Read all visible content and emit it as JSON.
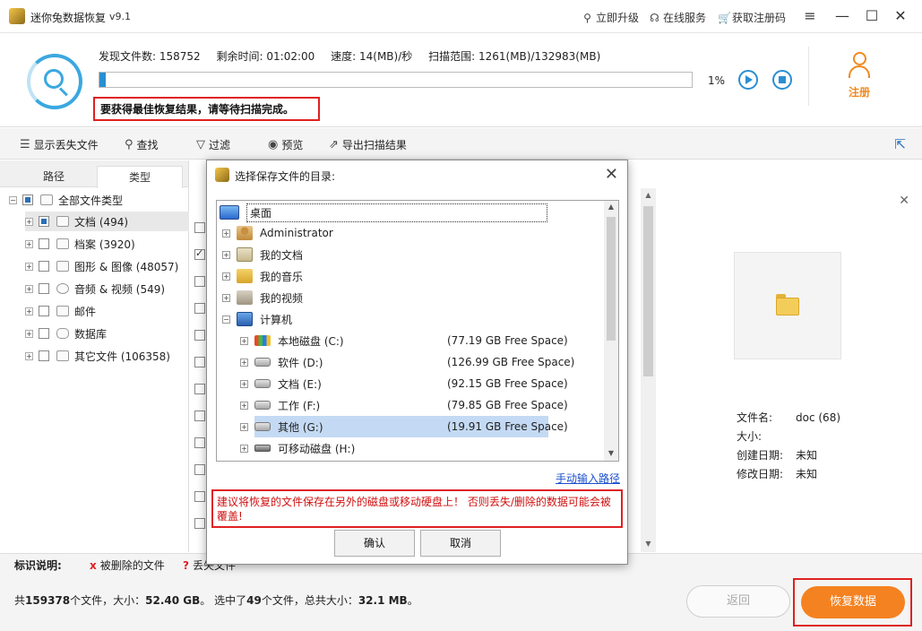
{
  "titlebar": {
    "title": "迷你兔数据恢复",
    "version": "v9.1",
    "upgrade": "立即升级",
    "online_service": "在线服务",
    "get_code": "获取注册码",
    "menu_icon": "hamburger-icon",
    "min_icon": "minimize-icon",
    "max_icon": "maximize-icon",
    "close_icon": "close-icon"
  },
  "scan": {
    "found_label": "发现文件数:",
    "found_value": "158752",
    "remain_label": "剩余时间:",
    "remain_value": "01:02:00",
    "speed_label": "速度:",
    "speed_value": "14(MB)/秒",
    "range_label": "扫描范围:",
    "range_value": "1261(MB)/132983(MB)",
    "progress_fraction": 0.01,
    "percent": "1%",
    "warning": "要获得最佳恢复结果，请等待扫描完成。",
    "register": "注册",
    "accent": "#2a8fd2",
    "register_color": "#f08a1e"
  },
  "toolbar": {
    "show_lost": "显示丢失文件",
    "search": "查找",
    "filter": "过滤",
    "preview": "预览",
    "export": "导出扫描结果"
  },
  "left": {
    "tab_path": "路径",
    "tab_type": "类型",
    "tree": [
      {
        "label": "全部文件类型"
      },
      {
        "label": "文档 (494)"
      },
      {
        "label": "档案 (3920)"
      },
      {
        "label": "图形 & 图像 (48057)"
      },
      {
        "label": "音频 & 视频 (549)"
      },
      {
        "label": "邮件"
      },
      {
        "label": "数据库"
      },
      {
        "label": "其它文件 (106358)"
      }
    ]
  },
  "preview": {
    "name_label": "文件名:",
    "name_value": "doc (68)",
    "size_label": "大小:",
    "size_value": "",
    "created_label": "创建日期:",
    "created_value": "未知",
    "modified_label": "修改日期:",
    "modified_value": "未知"
  },
  "legend": {
    "title": "标识说明:",
    "deleted": "被删除的文件",
    "lost_partial": "丢失文件"
  },
  "status": {
    "prefix": "共",
    "total_files": "159378",
    "mid1": "个文件，大小：",
    "total_size": "52.40 GB",
    "mid2": "。 选中了",
    "selected": "49",
    "mid3": "个文件，总共大小：",
    "selected_size": "32.1 MB",
    "suffix": "。",
    "back": "返回",
    "recover": "恢复数据",
    "recover_color": "#f58220"
  },
  "dialog": {
    "title": "选择保存文件的目录:",
    "desktop": "桌面",
    "items": [
      {
        "label": "Administrator",
        "free": ""
      },
      {
        "label": "我的文档",
        "free": ""
      },
      {
        "label": "我的音乐",
        "free": ""
      },
      {
        "label": "我的视频",
        "free": ""
      },
      {
        "label": "计算机",
        "free": ""
      },
      {
        "label": "本地磁盘 (C:)",
        "free": "(77.19 GB Free Space)"
      },
      {
        "label": "软件 (D:)",
        "free": "(126.99 GB Free Space)"
      },
      {
        "label": "文档 (E:)",
        "free": "(92.15 GB Free Space)"
      },
      {
        "label": "工作 (F:)",
        "free": "(79.85 GB Free Space)"
      },
      {
        "label": "其他 (G:)",
        "free": "(19.91 GB Free Space)"
      },
      {
        "label": "可移动磁盘 (H:)",
        "free": ""
      }
    ],
    "manual_path": "手动输入路径",
    "warning": "建议将恢复的文件保存在另外的磁盘或移动硬盘上！ 否则丢失/删除的数据可能会被覆盖!",
    "ok": "确认",
    "cancel": "取消"
  }
}
